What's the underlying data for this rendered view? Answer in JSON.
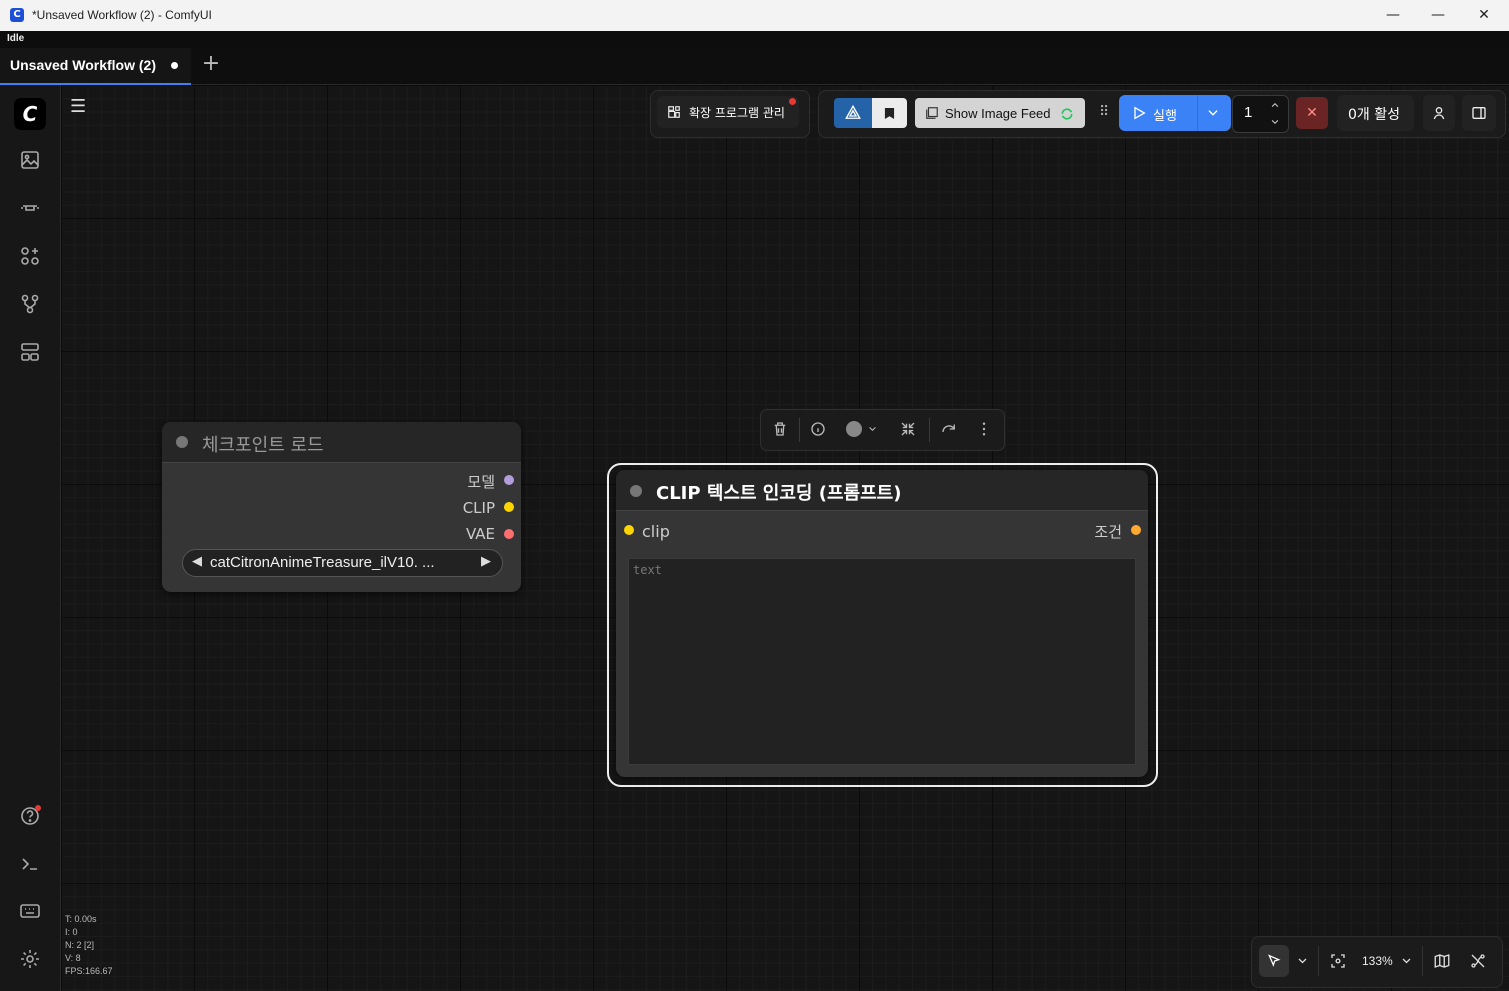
{
  "window": {
    "title": "*Unsaved Workflow (2) - ComfyUI",
    "app_icon_letter": "C",
    "minimize": "—",
    "maximize": "☐",
    "close": "✕"
  },
  "status": {
    "text": "Idle"
  },
  "tabs": {
    "active_label": "Unsaved Workflow (2)",
    "new_tab": "+"
  },
  "sidebar": {
    "logo": "C",
    "icons": [
      "images-icon",
      "model-library-icon",
      "node-library-icon",
      "workflows-icon",
      "templates-icon"
    ],
    "bottom_icons": [
      "help-icon",
      "terminal-icon",
      "keyboard-icon",
      "settings-icon"
    ]
  },
  "toolbar": {
    "extensions_label": "확장 프로그램 관리",
    "show_image_feed": "Show Image Feed",
    "run_label": "실행",
    "queue_count": "1",
    "active_label": "0개 활성",
    "cancel": "✕"
  },
  "nodes": {
    "checkpoint": {
      "title": "체크포인트 로드",
      "outputs": [
        "모델",
        "CLIP",
        "VAE"
      ],
      "ckpt_name": "catCitronAnimeTreasure_ilV10. ..."
    },
    "clip_text": {
      "title": "CLIP 텍스트 인코딩 (프롬프트)",
      "input": "clip",
      "output": "조건",
      "placeholder": "text"
    }
  },
  "stats": {
    "t": "T: 0.00s",
    "i": "I: 0",
    "n": "N: 2 [2]",
    "v": "V: 8",
    "fps": "FPS:166.67"
  },
  "canvas_controls": {
    "zoom": "133%"
  },
  "colors": {
    "accent": "#3b82f6",
    "model_slot": "#b39ddb",
    "clip_slot": "#ffd500",
    "vae_slot": "#ff6e6e",
    "cond_slot": "#ffa931"
  }
}
